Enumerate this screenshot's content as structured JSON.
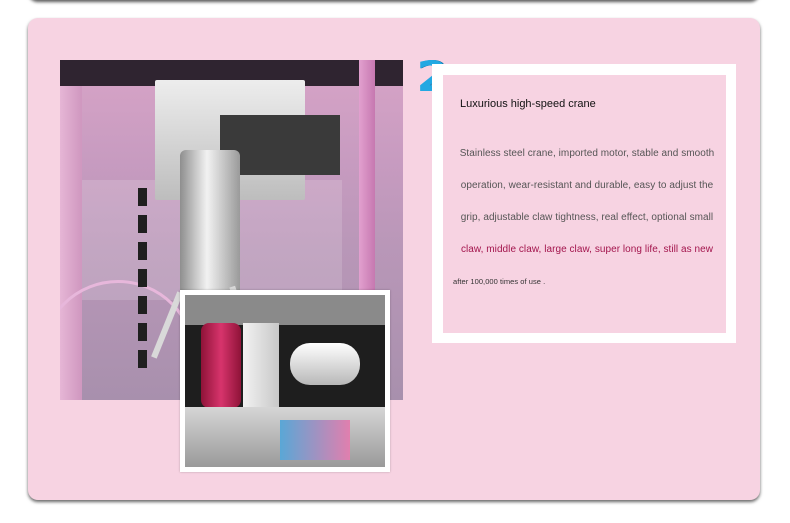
{
  "badge": {
    "number": "2"
  },
  "panel": {
    "title": "Luxurious high-speed crane",
    "lines": [
      "Stainless steel crane, imported motor, stable and smooth",
      "operation, wear-resistant and durable, easy to adjust the",
      "grip, adjustable claw tightness, real effect, optional small",
      "claw, middle claw, large claw, super long life, still as new",
      "after 100,000 times of use ."
    ]
  },
  "colors": {
    "card_background": "#f7d3e2",
    "badge_blue": "#23a8e2",
    "accent_text": "#a3154d"
  },
  "images": {
    "main_photo": "crane-claw-assembly-photo",
    "inset_photo": "crane-motor-spool-photo"
  }
}
